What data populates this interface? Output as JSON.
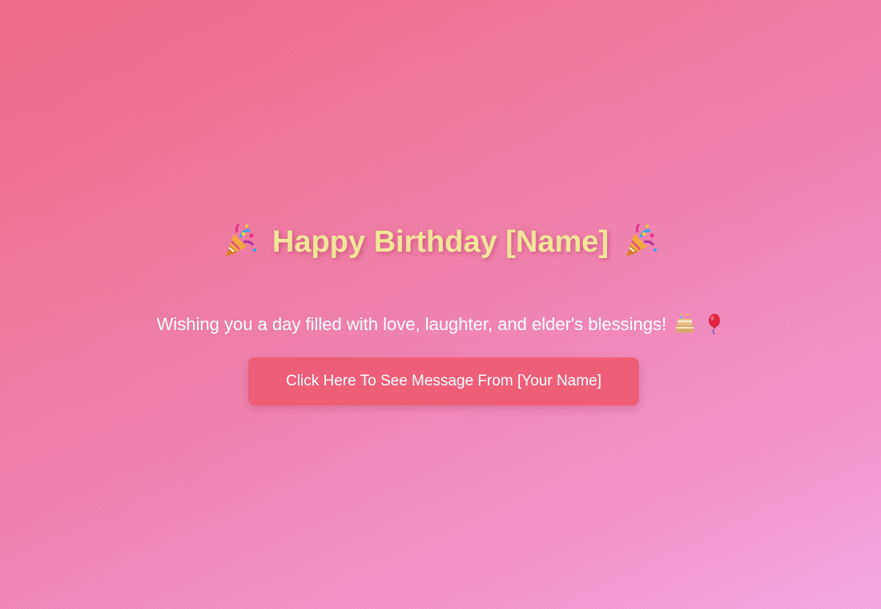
{
  "heading": {
    "text": "Happy Birthday [Name]",
    "left_icon": "party-popper-icon",
    "right_icon": "party-popper-icon",
    "color": "#f3e59a"
  },
  "subtitle": {
    "text": "Wishing you a day filled with love, laughter, and elder's blessings!",
    "icons": [
      "birthday-cake-icon",
      "balloon-icon"
    ],
    "color": "#ffffff"
  },
  "button": {
    "label": "Click Here To See Message From [Your Name]",
    "color": "#ee5f77"
  },
  "background": {
    "gradient": [
      "#ee6a8a",
      "#f07ea8",
      "#f491c8",
      "#f4a8e2"
    ]
  }
}
